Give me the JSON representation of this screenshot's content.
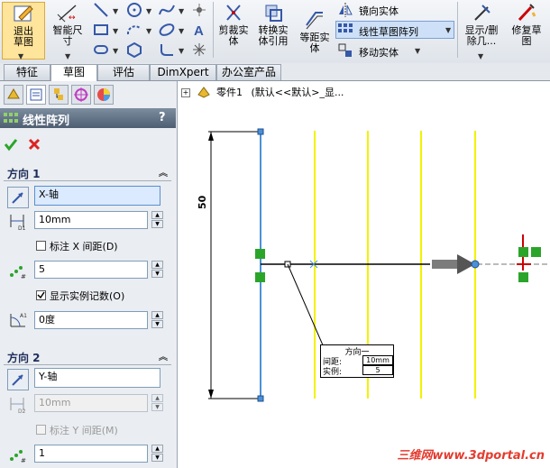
{
  "ribbon": {
    "exit_sketch": "退出草图",
    "smart_dim": "智能尺寸",
    "trim": "剪裁实体",
    "convert": "转换实体引用",
    "offset": "等距实体",
    "mirror": "镜向实体",
    "linear_pattern": "线性草图阵列",
    "move": "移动实体",
    "display_delete": "显示/删除几...",
    "repair": "修复草图"
  },
  "tabs": [
    "特征",
    "草图",
    "评估",
    "DimXpert",
    "办公室产品"
  ],
  "active_tab": "草图",
  "tree": {
    "part": "零件1",
    "config": "(默认<<默认>_显..."
  },
  "pm": {
    "title": "线性阵列",
    "help": "?",
    "dir1": {
      "header": "方向 1",
      "axis": "X-轴",
      "spacing": "10mm",
      "dim_spacing_label": "标注 X 间距(D)",
      "dim_spacing_checked": false,
      "count": "5",
      "show_count_label": "显示实例记数(O)",
      "show_count_checked": true,
      "angle": "0度"
    },
    "dir2": {
      "header": "方向 2",
      "axis": "Y-轴",
      "spacing": "10mm",
      "dim_spacing_label": "标注 Y 间距(M)",
      "dim_spacing_checked": false,
      "count": "1"
    }
  },
  "graphics": {
    "dimension": "50",
    "callout": {
      "title": "方向一",
      "spacing_label": "间距:",
      "spacing_value": "10mm",
      "count_label": "实例:",
      "count_value": "5"
    },
    "watermark": "三维网www.3dportal.cn"
  },
  "colors": {
    "pattern_lines": "#f2f200",
    "sketch_line": "#4a90d9",
    "header_bg": "#5b6b80"
  }
}
